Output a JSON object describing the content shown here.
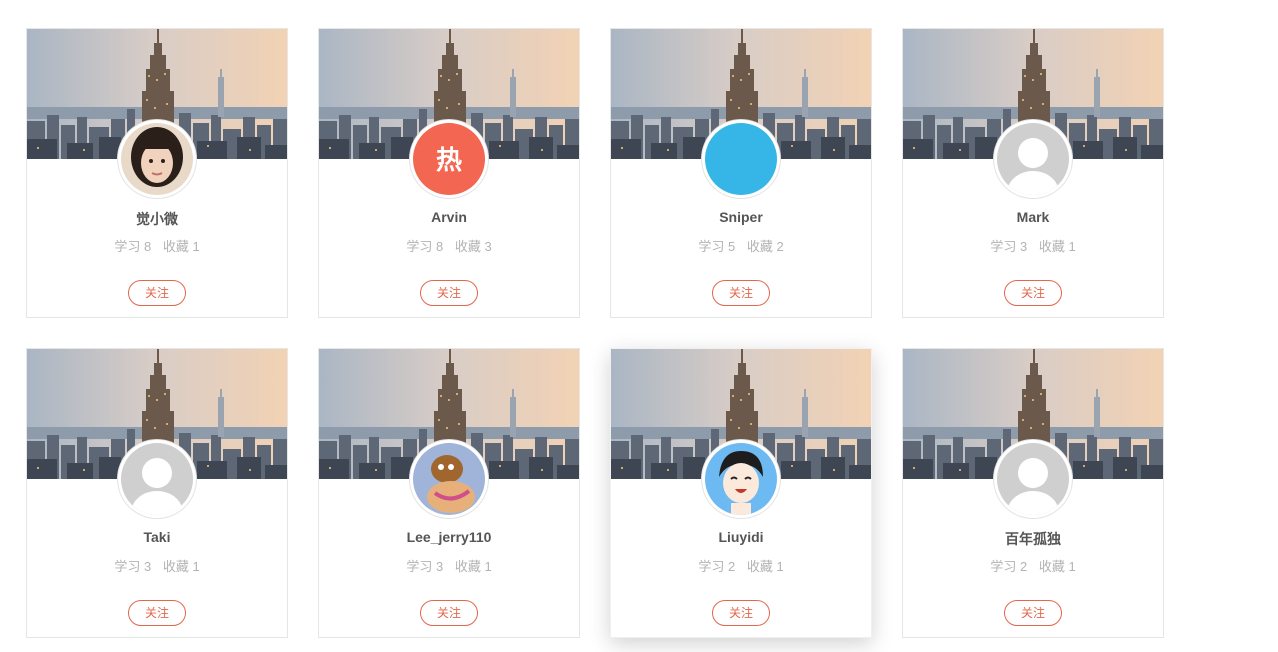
{
  "follow_label": "关注",
  "users": [
    {
      "name": "觉小微",
      "study_label": "学习",
      "study": "8",
      "fav_label": "收藏",
      "fav": "1",
      "avatar": "photo-girl"
    },
    {
      "name": "Arvin",
      "study_label": "学习",
      "study": "8",
      "fav_label": "收藏",
      "fav": "3",
      "avatar": "text-avatar",
      "avatar_text": "热",
      "avatar_color": "#f36651"
    },
    {
      "name": "Sniper",
      "study_label": "学习",
      "study": "5",
      "fav_label": "收藏",
      "fav": "2",
      "avatar": "code-icon",
      "avatar_text": "</>",
      "avatar_color": "#35b6e7"
    },
    {
      "name": "Mark",
      "study_label": "学习",
      "study": "3",
      "fav_label": "收藏",
      "fav": "1",
      "avatar": "default-user-icon"
    },
    {
      "name": "Taki",
      "study_label": "学习",
      "study": "3",
      "fav_label": "收藏",
      "fav": "1",
      "avatar": "default-user-icon"
    },
    {
      "name": "Lee_jerry110",
      "study_label": "学习",
      "study": "3",
      "fav_label": "收藏",
      "fav": "1",
      "avatar": "cartoon-avatar"
    },
    {
      "name": "Liuyidi",
      "study_label": "学习",
      "study": "2",
      "fav_label": "收藏",
      "fav": "1",
      "avatar": "cartoon-boy-avatar"
    },
    {
      "name": "百年孤独",
      "study_label": "学习",
      "study": "2",
      "fav_label": "收藏",
      "fav": "1",
      "avatar": "default-user-icon"
    }
  ],
  "colors": {
    "accent": "#e3674d",
    "name": "#555555",
    "stats": "#b3b3b3"
  }
}
